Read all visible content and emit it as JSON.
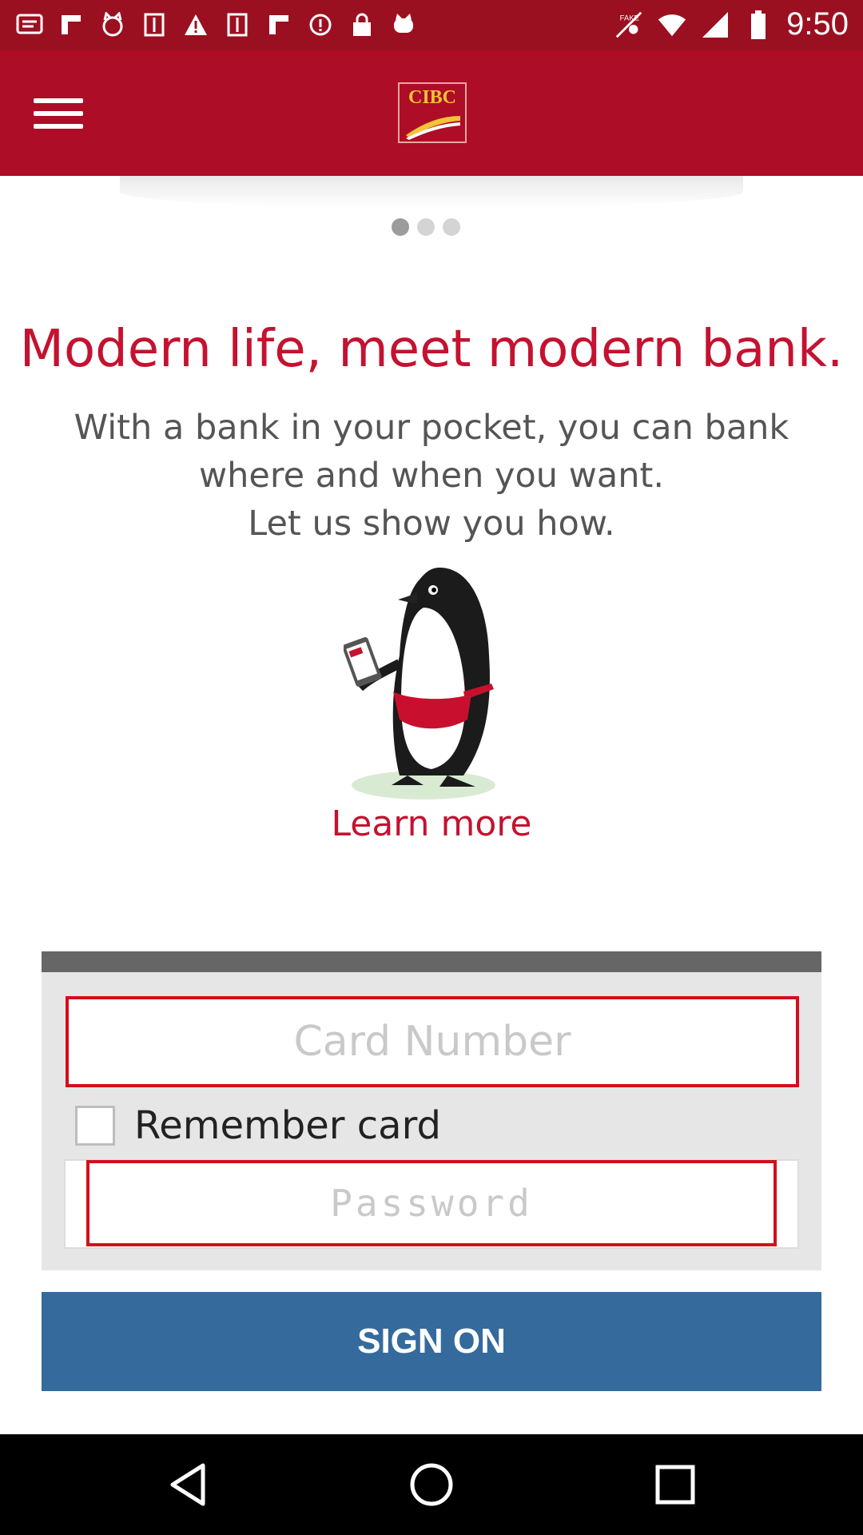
{
  "status_bar": {
    "time": "9:50",
    "left_icons": [
      "message-icon",
      "flipboard-icon",
      "cat-icon",
      "app-icon",
      "warning-icon",
      "app2-icon",
      "flipboard2-icon",
      "info-icon",
      "lock-icon",
      "cat2-icon"
    ],
    "right_icons": [
      "fake-gps-icon",
      "wifi-icon",
      "signal-icon",
      "battery-icon"
    ]
  },
  "app_bar": {
    "logo_text": "CIBC",
    "accent_color": "#ad0d26"
  },
  "carousel": {
    "page_count": 3,
    "active_index": 0,
    "headline": "Modern life, meet modern bank.",
    "subtext_lines": [
      "With a bank in your pocket, you can bank",
      "where and when you want.",
      "Let us show you how."
    ],
    "learn_more": "Learn more"
  },
  "login": {
    "card_placeholder": "Card Number",
    "remember_label": "Remember card",
    "remember_checked": false,
    "password_placeholder": "Password",
    "sign_on": "SIGN ON"
  },
  "colors": {
    "brand_red": "#c41230",
    "button_blue": "#356a9c"
  }
}
